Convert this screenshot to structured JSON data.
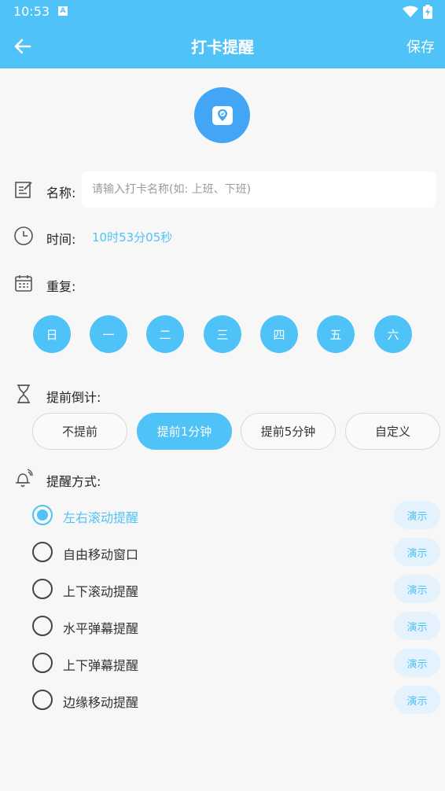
{
  "status_bar": {
    "time": "10:53",
    "notif_glyph": "A",
    "icons": [
      "wifi-icon",
      "battery-charging-icon"
    ]
  },
  "app_bar": {
    "title": "打卡提醒",
    "save_label": "保存",
    "back_icon": "arrow-left-icon"
  },
  "colors": {
    "primary": "#4fc3f7",
    "avatar_bg": "#42a5f5",
    "demo_bg": "#e3f2fd"
  },
  "form": {
    "name": {
      "label": "名称:",
      "placeholder": "请输入打卡名称(如: 上班、下班)",
      "value": ""
    },
    "time": {
      "label": "时间:",
      "value": "10时53分05秒"
    },
    "repeat": {
      "label": "重复:",
      "days": [
        "日",
        "一",
        "二",
        "三",
        "四",
        "五",
        "六"
      ]
    },
    "countdown": {
      "label": "提前倒计:",
      "options": [
        "不提前",
        "提前1分钟",
        "提前5分钟",
        "自定义"
      ],
      "selected": "提前1分钟"
    },
    "reminder": {
      "label": "提醒方式:",
      "demo_label": "演示",
      "options": [
        "左右滚动提醒",
        "自由移动窗口",
        "上下滚动提醒",
        "水平弹幕提醒",
        "上下弹幕提醒",
        "边缘移动提醒"
      ],
      "selected": "左右滚动提醒"
    }
  }
}
